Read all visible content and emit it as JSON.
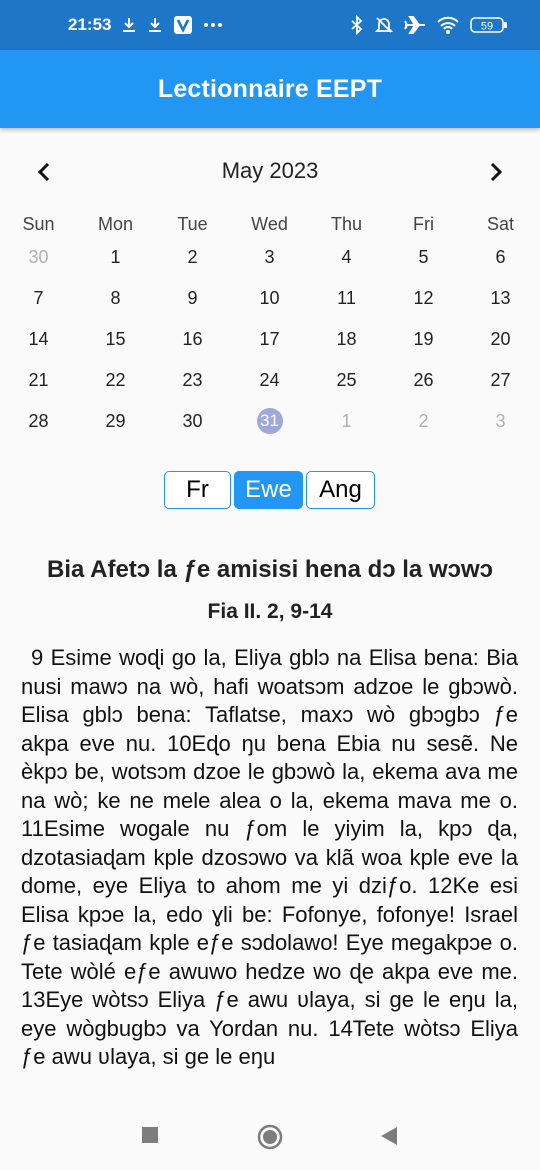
{
  "status_bar": {
    "time": "21:53",
    "battery": "59",
    "left_icons": [
      "download-icon",
      "download-icon",
      "v-app-icon",
      "more-dots-icon"
    ],
    "right_icons": [
      "bluetooth-icon",
      "mute-icon",
      "airplane-icon",
      "wifi-icon",
      "battery-icon"
    ]
  },
  "app_bar": {
    "title": "Lectionnaire EEPT"
  },
  "calendar": {
    "month_label": "May 2023",
    "prev_icon": "chevron-left-icon",
    "next_icon": "chevron-right-icon",
    "weekdays": [
      "Sun",
      "Mon",
      "Tue",
      "Wed",
      "Thu",
      "Fri",
      "Sat"
    ],
    "weeks": [
      [
        "30",
        "1",
        "2",
        "3",
        "4",
        "5",
        "6"
      ],
      [
        "7",
        "8",
        "9",
        "10",
        "11",
        "12",
        "13"
      ],
      [
        "14",
        "15",
        "16",
        "17",
        "18",
        "19",
        "20"
      ],
      [
        "21",
        "22",
        "23",
        "24",
        "25",
        "26",
        "27"
      ],
      [
        "28",
        "29",
        "30",
        "31",
        "1",
        "2",
        "3"
      ]
    ],
    "selected_day": "31",
    "selected_color": "#9ea8da"
  },
  "languages": {
    "options": [
      "Fr",
      "Ewe",
      "Ang"
    ],
    "active": "Ewe",
    "accent": "#2196f3"
  },
  "reading": {
    "title": "Bia Afetɔ la ƒe amisisi hena dɔ la wɔwɔ",
    "reference": "Fia II. 2, 9-14",
    "text": "9 Esime woɖi go la, Eliya gblɔ na Elisa bena: Bia nusi mawɔ na wò, hafi woatsɔm adzoe le gbɔwò. Elisa gblɔ bena: Taflatse, maxɔ wò gbɔgbɔ ƒe akpa eve nu. 10Eɖo ŋu bena Ebia nu sesẽ. Ne èkpɔ be, wotsɔm dzoe le gbɔwò la, ekema ava me na wò; ke ne mele alea o la, ekema mava me o. 11Esime wogale nu ƒom le yiyim la, kpɔ ɖa, dzotasiaɖam kple dzosɔwo va klã woa kple eve la dome, eye Eliya to ahom me yi dziƒo. 12Ke esi Elisa kpɔe la, edo ɣli be: Fofonye, fofonye! Israel ƒe tasiaɖam kple eƒe sɔdolawo! Eye megakpɔe o. Tete wòlé eƒe awuwo hedze wo ɖe akpa eve me. 13Eye wòtsɔ Eliya ƒe awu ʋlaya, si ge le eŋu la, eye wògbugbɔ va Yordan nu. 14Tete wòtsɔ Eliya ƒe awu ʋlaya, si ge le eŋu"
  },
  "nav_bar": {
    "keys": [
      "recents-square-icon",
      "home-circle-icon",
      "back-triangle-icon"
    ]
  },
  "colors": {
    "status_bar": "#1e76c8",
    "app_bar": "#2196f3",
    "background": "#fafafa"
  }
}
